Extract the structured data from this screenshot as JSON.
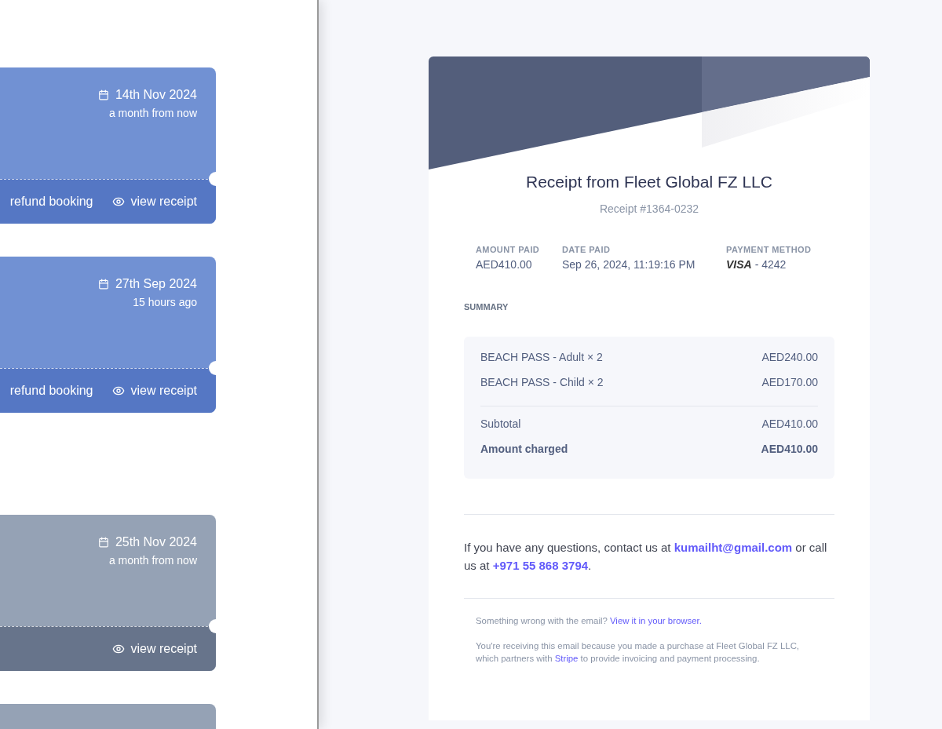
{
  "bookings": [
    {
      "kind": "active",
      "date": "14th Nov 2024",
      "relative": "a month from now",
      "actions": [
        {
          "kind": "refund",
          "label": "refund booking"
        },
        {
          "kind": "view",
          "label": "view receipt"
        }
      ]
    },
    {
      "kind": "active",
      "date": "27th Sep 2024",
      "relative": "15 hours ago",
      "actions": [
        {
          "kind": "refund",
          "label": "refund booking"
        },
        {
          "kind": "view",
          "label": "view receipt"
        }
      ]
    },
    {
      "kind": "past",
      "date": "25th Nov 2024",
      "relative": "a month from now",
      "actions": [
        {
          "kind": "view",
          "label": "view receipt"
        }
      ]
    },
    {
      "kind": "past"
    }
  ],
  "receipt": {
    "title": "Receipt from Fleet Global FZ LLC",
    "number": "Receipt #1364-0232",
    "meta": [
      {
        "label": "AMOUNT PAID",
        "value": "AED410.00"
      },
      {
        "label": "DATE PAID",
        "value": "Sep 26, 2024, 11:19:16 PM"
      },
      {
        "label": "PAYMENT METHOD",
        "brand": "VISA",
        "value": "- 4242"
      }
    ],
    "summary_label": "SUMMARY",
    "items": [
      {
        "name": "BEACH PASS - Adult × 2",
        "amount": "AED240.00"
      },
      {
        "name": "BEACH PASS - Child × 2",
        "amount": "AED170.00"
      }
    ],
    "totals": [
      {
        "label": "Subtotal",
        "amount": "AED410.00",
        "bold": false
      },
      {
        "label": "Amount charged",
        "amount": "AED410.00",
        "bold": true
      }
    ],
    "contact": {
      "before": "If you have any questions, contact us at",
      "email": "kumailht@gmail.com",
      "middle": "or call us at",
      "phone": "+971 55 868 3794",
      "after": "."
    },
    "footer": [
      {
        "text": "Something wrong with the email?",
        "link": "View it in your browser."
      },
      {
        "text": "You're receiving this email because you made a purchase at Fleet Global FZ LLC, which partners with",
        "link": "Stripe",
        "after": "to provide invoicing and payment processing."
      }
    ]
  }
}
